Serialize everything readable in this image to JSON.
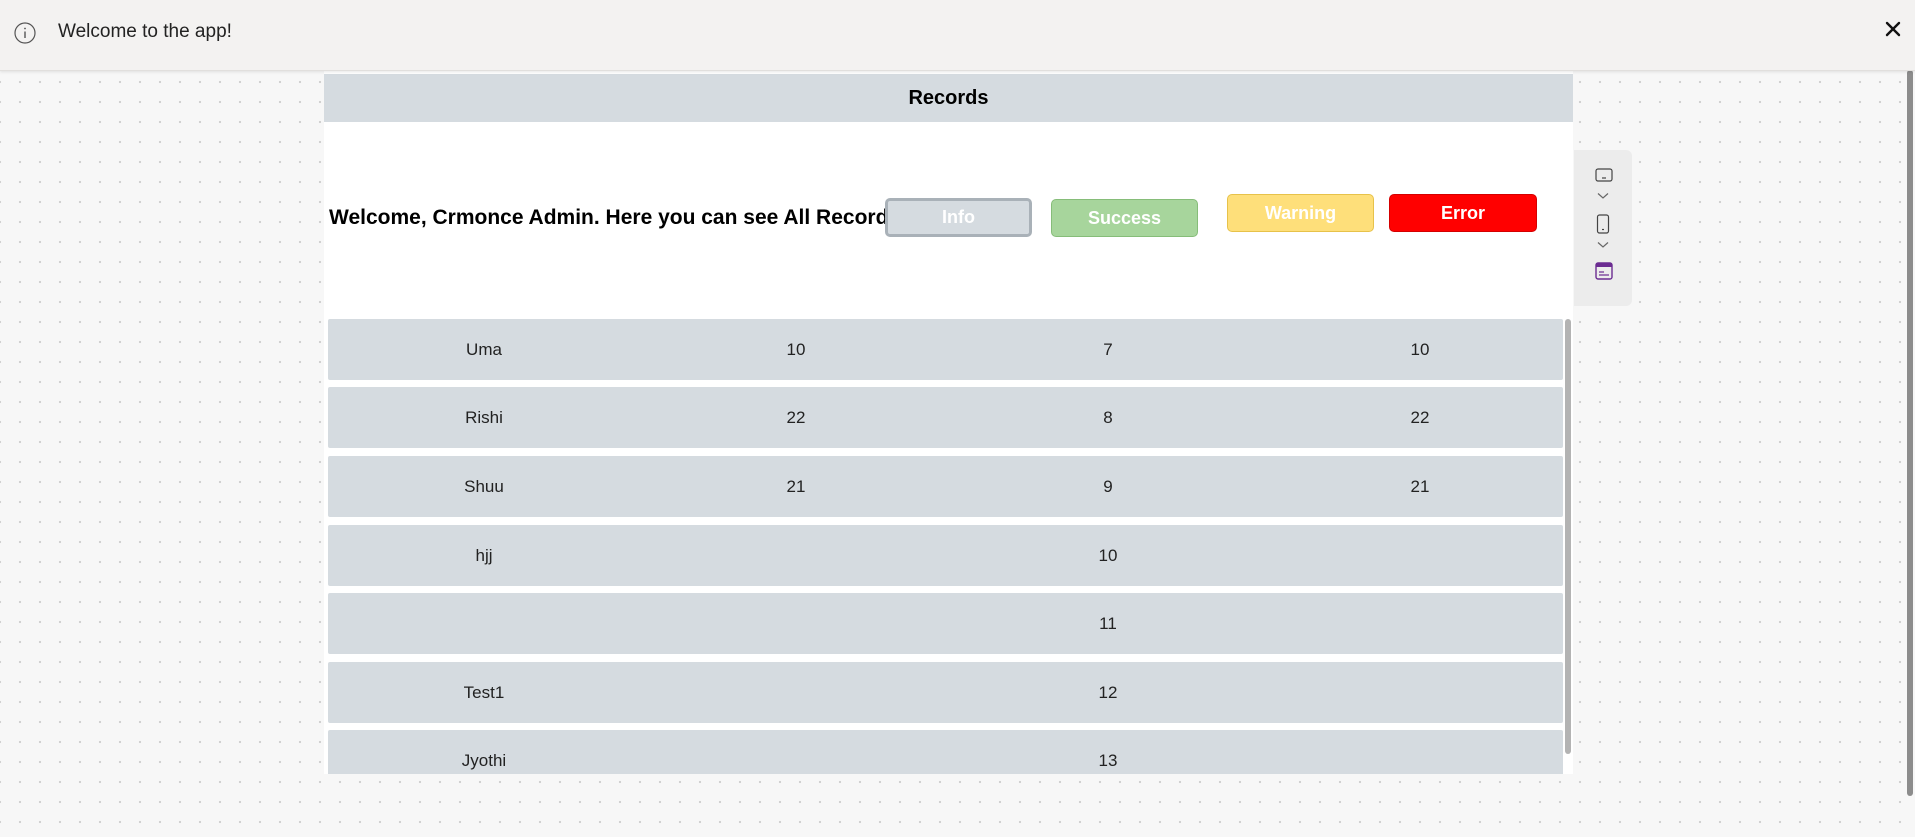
{
  "notification": {
    "message": "Welcome to the app!",
    "info_icon": "info-icon",
    "close_icon": "close-icon"
  },
  "panel": {
    "title": "Records",
    "welcome_text": "Welcome, Crmonce Admin. Here you can see All Records."
  },
  "buttons": {
    "info": "Info",
    "success": "Success",
    "warning": "Warning",
    "error": "Error"
  },
  "colors": {
    "info": "#d5dbe0",
    "success": "#a7d59c",
    "warning": "#fedf7a",
    "error": "#ff0000",
    "row": "#d5dbe0",
    "header": "#d5dbe0"
  },
  "records": [
    [
      "Uma",
      "10",
      "7",
      "10"
    ],
    [
      "Rishi",
      "22",
      "8",
      "22"
    ],
    [
      "Shuu",
      "21",
      "9",
      "21"
    ],
    [
      "hjj",
      "",
      "10",
      ""
    ],
    [
      "",
      "",
      "11",
      ""
    ],
    [
      "Test1",
      "",
      "12",
      ""
    ],
    [
      "Jyothi",
      "",
      "13",
      ""
    ]
  ],
  "side_toolbar": [
    "desktop-icon",
    "chevron-down-icon",
    "mobile-icon",
    "chevron-down-icon",
    "app-window-icon"
  ]
}
